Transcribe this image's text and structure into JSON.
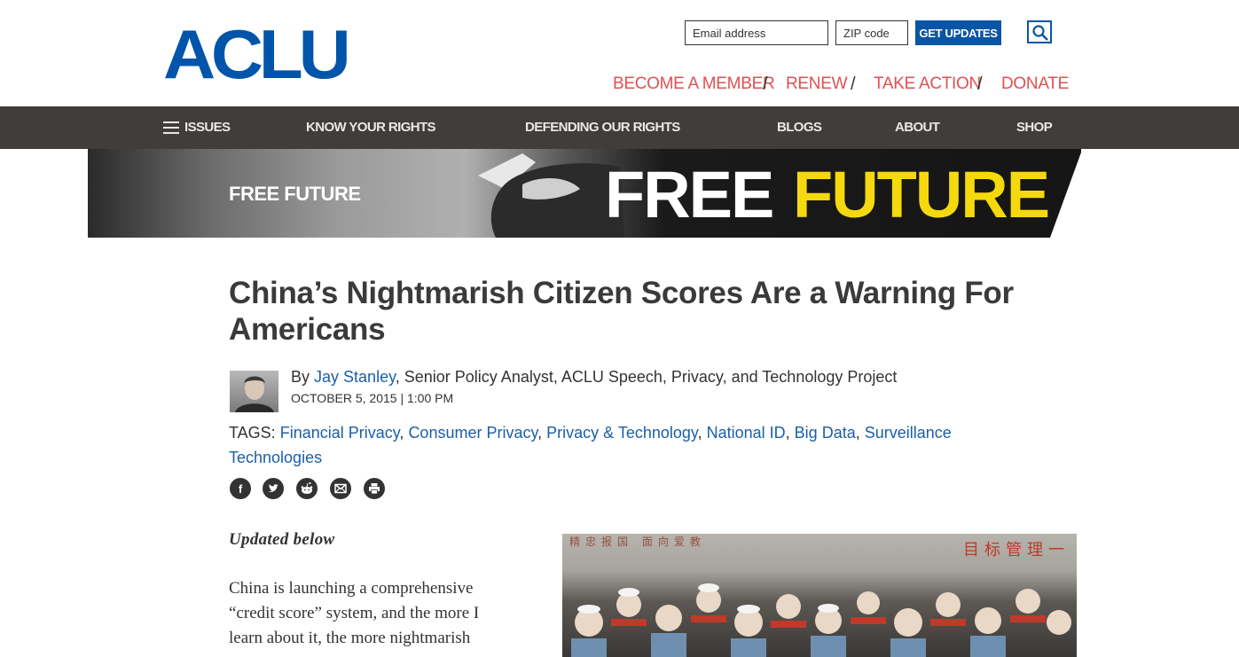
{
  "header": {
    "logo": "ACLU",
    "email_placeholder": "Email address",
    "zip_placeholder": "ZIP code",
    "updates_label": "GET UPDATES",
    "top_links": [
      "BECOME A MEMBER",
      "RENEW",
      "TAKE ACTION",
      "DONATE"
    ],
    "separator": "/"
  },
  "nav": {
    "items": [
      "ISSUES",
      "KNOW YOUR RIGHTS",
      "DEFENDING OUR RIGHTS",
      "BLOGS",
      "ABOUT",
      "SHOP"
    ]
  },
  "banner": {
    "label": "FREE FUTURE",
    "word1": "FREE",
    "word2": "FUTURE"
  },
  "article": {
    "title": "China’s Nightmarish Citizen Scores Are a Warning For Americans",
    "by_prefix": "By",
    "author": "Jay Stanley",
    "author_role": ", Senior Policy Analyst, ACLU Speech, Privacy, and Technology Project",
    "date": "OCTOBER 5, 2015 | 1:00 PM",
    "tags_label": "TAGS:",
    "tags": [
      "Financial Privacy",
      "Consumer Privacy",
      "Privacy & Technology",
      "National ID",
      "Big Data",
      "Surveillance Technologies"
    ],
    "updated": "Updated  below",
    "body_lines": [
      "China is launching a comprehensive",
      "“credit score” system, and the more I",
      "learn about it, the more nightmarish"
    ],
    "photo_sign": "目标管理一",
    "photo_sign2": "精忠报国 面向爱教"
  },
  "share_icons": [
    "facebook-icon",
    "twitter-icon",
    "reddit-icon",
    "email-icon",
    "print-icon"
  ],
  "colors": {
    "brand_blue": "#0055aa",
    "link_blue": "#1a5fa6",
    "top_link_red": "#e05050",
    "nav_bg": "#413d3a",
    "future_yellow": "#f5d90e"
  }
}
